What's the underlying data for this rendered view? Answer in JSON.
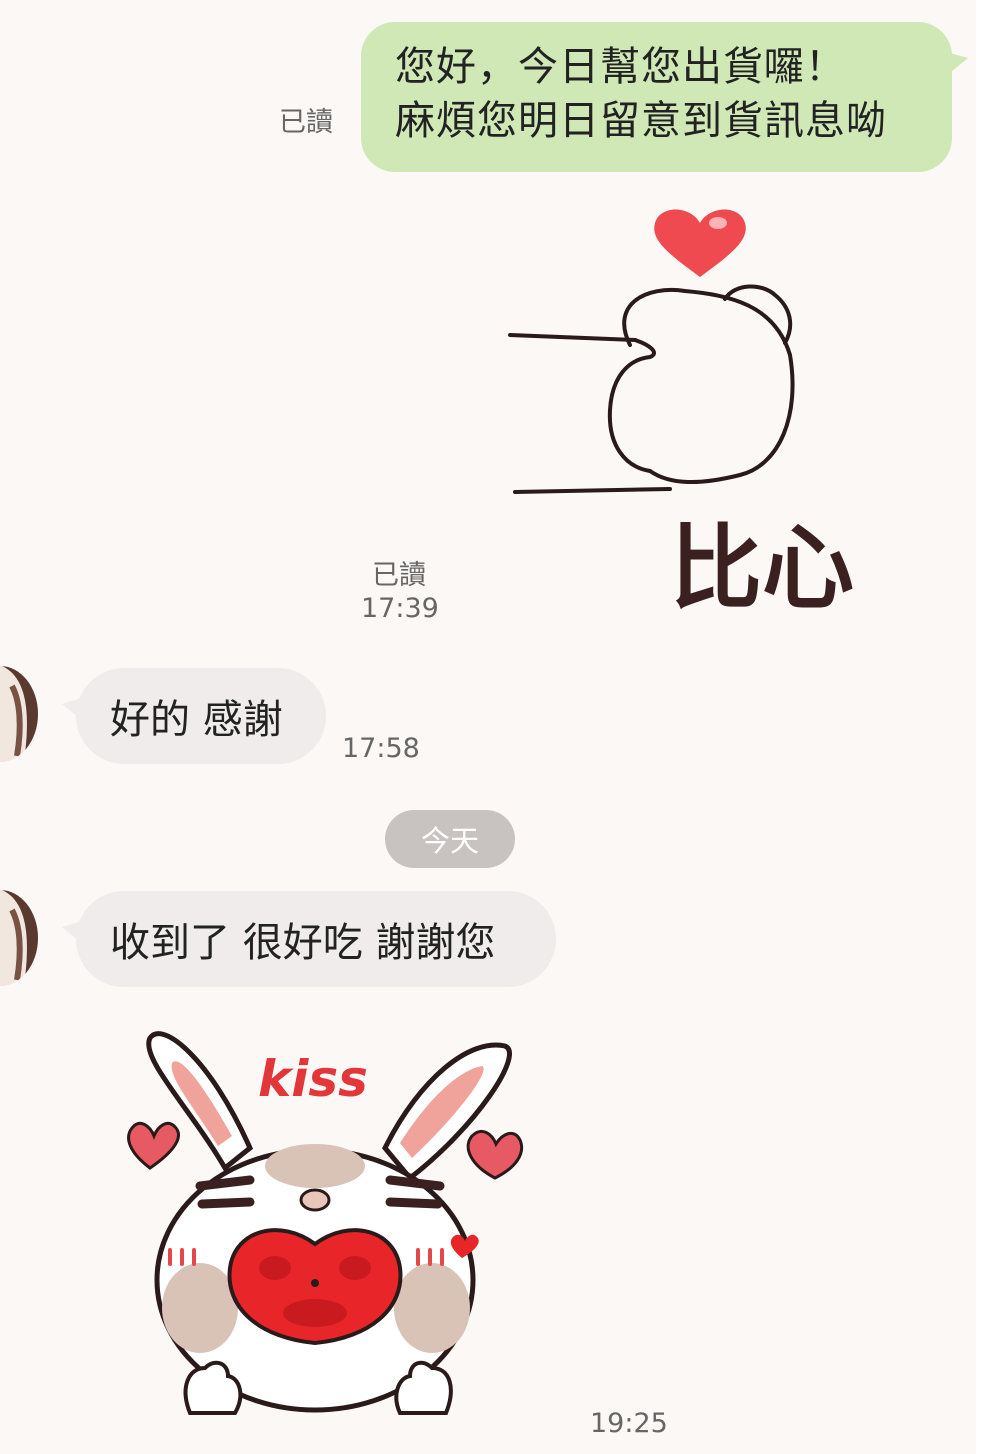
{
  "chat": {
    "msg1": {
      "lines": [
        "您好，今日幫您出貨囉！",
        "麻煩您明日留意到貨訊息呦"
      ],
      "read": "已讀"
    },
    "sticker1": {
      "text": "比心",
      "read": "已讀",
      "time": "17:39"
    },
    "msg2": {
      "text": "好的 感謝",
      "time": "17:58"
    },
    "date_divider": "今天",
    "msg3": {
      "text": "收到了 很好吃 謝謝您"
    },
    "sticker2": {
      "text": "kiss",
      "time": "19:25"
    }
  },
  "colors": {
    "background": "#fbf8f5",
    "outgoing_bubble": "#cfe8b6",
    "incoming_bubble": "#efeceb",
    "date_pill": "#c8c2c0"
  }
}
